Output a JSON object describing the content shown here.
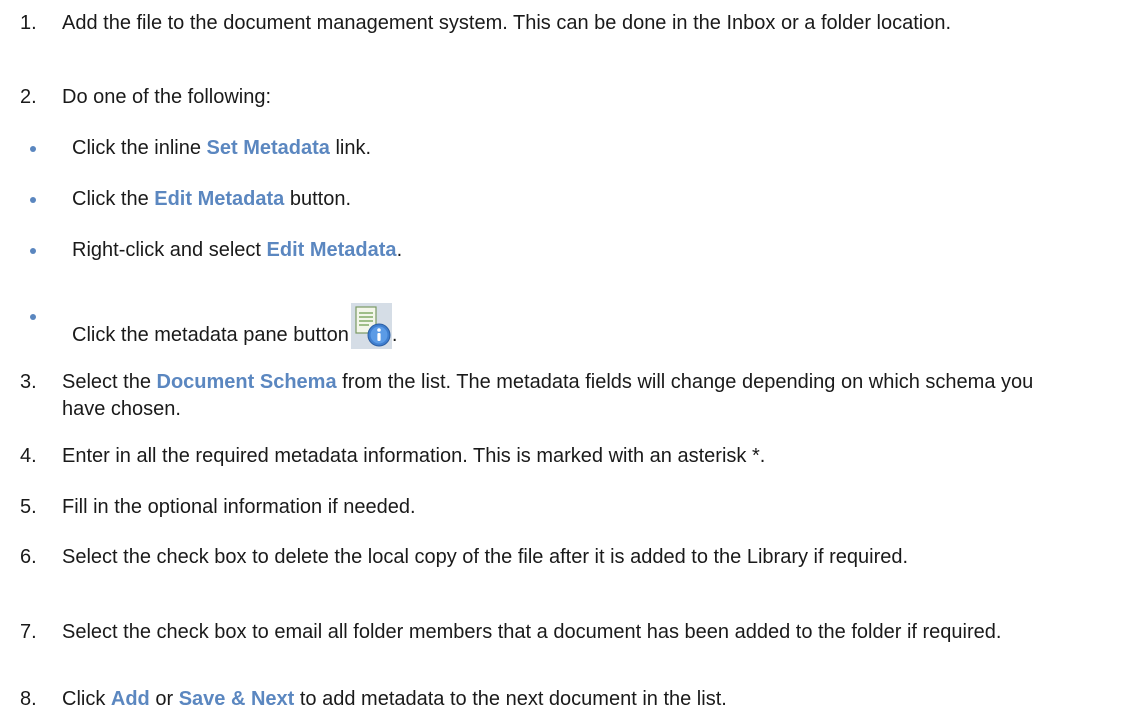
{
  "steps": [
    {
      "num": "1.",
      "text": "Add the file to the document management system. This can be done in the Inbox or a folder location."
    },
    {
      "num": "2.",
      "text": "Do one of the following:"
    },
    {
      "num": "3.",
      "pre": "Select the ",
      "hl": "Document Schema",
      "post": " from the list. The metadata fields will change depending on which schema you have chosen."
    },
    {
      "num": "4.",
      "text": "Enter in all the required metadata information. This is marked with an asterisk *."
    },
    {
      "num": "5.",
      "text": "Fill in the optional information if needed."
    },
    {
      "num": "6.",
      "text": "Select the check box to delete the local copy of the file after it is added to the Library if required."
    },
    {
      "num": "7.",
      "text": "Select the check box to email all folder members that a document has been added to the folder if required."
    },
    {
      "num": "8.",
      "pre": "Click ",
      "hl1": "Add",
      "mid": " or ",
      "hl2": "Save & Next",
      "post": " to add metadata to the next document in the list."
    }
  ],
  "bullets": [
    {
      "pre": "Click the inline ",
      "hl": "Set Metadata",
      "post": " link."
    },
    {
      "pre": "Click the ",
      "hl": "Edit Metadata",
      "post": " button."
    },
    {
      "pre": "Right-click and select ",
      "hl": "Edit Metadata",
      "post": "."
    },
    {
      "pre": "Click the metadata pane button",
      "icon": "metadata-pane-icon",
      "post": "."
    }
  ],
  "colors": {
    "highlight": "#5b87c0",
    "bullet": "#5a86bf"
  }
}
